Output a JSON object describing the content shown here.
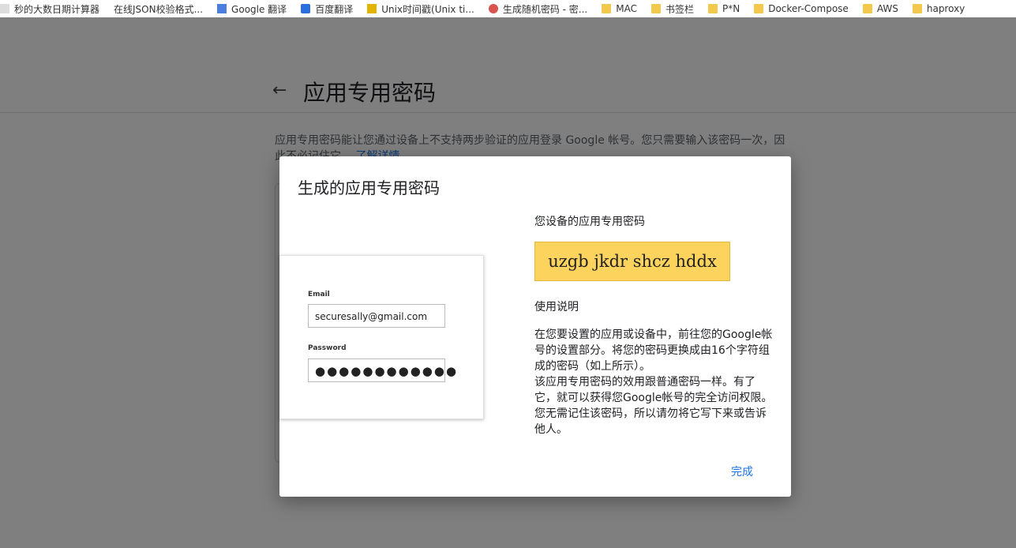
{
  "bookmarks": [
    {
      "icon": "blank-icon",
      "label": "秒的大数日期计算器"
    },
    {
      "icon": "page-icon",
      "label": "在线JSON校验格式..."
    },
    {
      "icon": "google-translate-icon",
      "label": "Google 翻译"
    },
    {
      "icon": "baidu-translate-icon",
      "label": "百度翻译"
    },
    {
      "icon": "unix-time-icon",
      "label": "Unix时间戳(Unix ti..."
    },
    {
      "icon": "password-generator-icon",
      "label": "生成随机密码 - 密..."
    },
    {
      "icon": "folder-icon",
      "label": "MAC"
    },
    {
      "icon": "folder-icon",
      "label": "书签栏"
    },
    {
      "icon": "folder-icon",
      "label": "P*N"
    },
    {
      "icon": "folder-icon",
      "label": "Docker-Compose"
    },
    {
      "icon": "folder-icon",
      "label": "AWS"
    },
    {
      "icon": "folder-icon",
      "label": "haproxy"
    }
  ],
  "page": {
    "title": "应用专用密码",
    "description": "应用专用密码能让您通过设备上不支持两步验证的应用登录 Google 帐号。您只需要输入该密码一次，因此不必记住它。",
    "learn_more": "了解详情"
  },
  "dialog": {
    "title": "生成的应用专用密码",
    "illustration": {
      "email_label": "Email",
      "email_value": "securesally@gmail.com",
      "password_label": "Password",
      "password_value": "●●●●●●●●●●●●"
    },
    "password_label": "您设备的应用专用密码",
    "password": "uzgb jkdr shcz hddx",
    "usage_title": "使用说明",
    "usage_p1": "在您要设置的应用或设备中，前往您的Google帐号的设置部分。将您的密码更换成由16个字符组成的密码（如上所示）。",
    "usage_p2": "该应用专用密码的效用跟普通密码一样。有了它，就可以获得您Google帐号的完全访问权限。您无需记住该密码，所以请勿将它写下来或告诉他人。",
    "done_label": "完成"
  },
  "colors": {
    "password_bg": "#fcd35c",
    "link": "#1a73e8",
    "scrim": "rgba(0,0,0,0.5)"
  }
}
